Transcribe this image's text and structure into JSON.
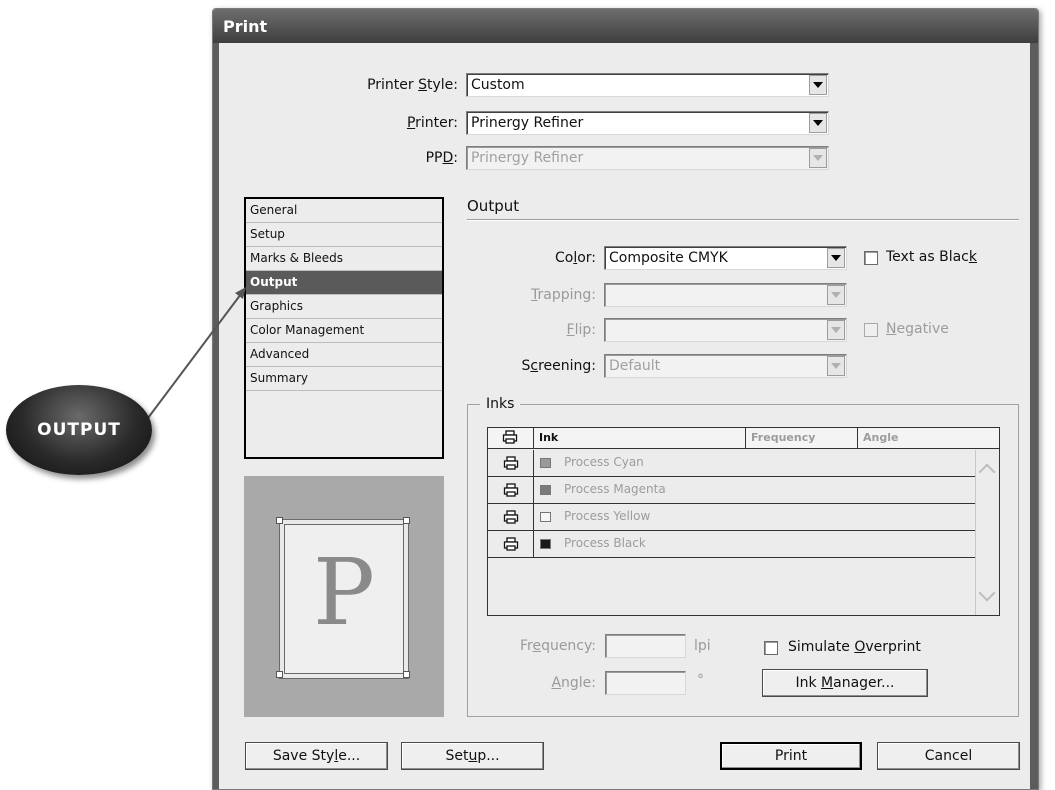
{
  "window": {
    "title": "Print"
  },
  "top_fields": {
    "printer_style": {
      "label_pre": "Printer ",
      "label_key": "S",
      "label_post": "tyle:",
      "value": "Custom"
    },
    "printer": {
      "label_pre": "",
      "label_key": "P",
      "label_post": "rinter:",
      "value": "Prinergy Refiner"
    },
    "ppd": {
      "label_pre": "PP",
      "label_key": "D",
      "label_post": ":",
      "value": "Prinergy Refiner"
    }
  },
  "categories": [
    {
      "label": "General"
    },
    {
      "label": "Setup"
    },
    {
      "label": "Marks & Bleeds"
    },
    {
      "label": "Output"
    },
    {
      "label": "Graphics"
    },
    {
      "label": "Color Management"
    },
    {
      "label": "Advanced"
    },
    {
      "label": "Summary"
    }
  ],
  "preview": {
    "letter": "P"
  },
  "output": {
    "heading": "Output",
    "color": {
      "label_pre": "Co",
      "label_key": "l",
      "label_post": "or:",
      "value": "Composite CMYK"
    },
    "text_as_black": {
      "label_pre": "Text as Blac",
      "label_key": "k",
      "label_post": ""
    },
    "trapping": {
      "label_pre": "",
      "label_key": "T",
      "label_post": "rapping:",
      "value": ""
    },
    "flip": {
      "label_pre": "",
      "label_key": "F",
      "label_post": "lip:",
      "value": ""
    },
    "negative": {
      "label_pre": "",
      "label_key": "N",
      "label_post": "egative"
    },
    "screening": {
      "label_pre": "S",
      "label_key": "c",
      "label_post": "reening:",
      "value": "Default"
    }
  },
  "inks": {
    "title": "Inks",
    "columns": {
      "ink": "Ink",
      "frequency": "Frequency",
      "angle": "Angle"
    },
    "rows": [
      {
        "name": "Process Cyan",
        "swatch": "#9a9a9a"
      },
      {
        "name": "Process Magenta",
        "swatch": "#7a7a7a"
      },
      {
        "name": "Process Yellow",
        "swatch": "#f6f6f6"
      },
      {
        "name": "Process Black",
        "swatch": "#1a1a1a"
      }
    ],
    "frequency": {
      "label_pre": "Fr",
      "label_key": "e",
      "label_post": "quency:",
      "unit": "lpi",
      "value": ""
    },
    "angle": {
      "label_pre": "",
      "label_key": "A",
      "label_post": "ngle:",
      "unit": "°",
      "value": ""
    },
    "simulate_overprint": {
      "label_pre": "Simulate ",
      "label_key": "O",
      "label_post": "verprint"
    },
    "ink_manager": {
      "label_pre": "Ink ",
      "label_key": "M",
      "label_post": "anager..."
    }
  },
  "buttons": {
    "save_style": {
      "label_pre": "Save Sty",
      "label_key": "l",
      "label_post": "e..."
    },
    "setup": {
      "label_pre": "Set",
      "label_key": "u",
      "label_post": "p..."
    },
    "print": {
      "label": "Print"
    },
    "cancel": {
      "label": "Cancel"
    }
  },
  "callout": {
    "label": "OUTPUT"
  }
}
